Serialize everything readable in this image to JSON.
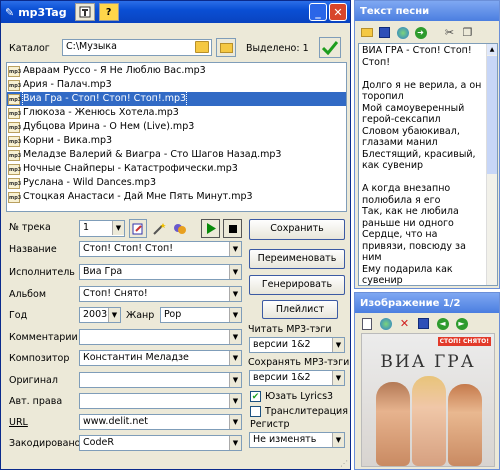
{
  "app": {
    "title": "mp3Tag"
  },
  "catalog": {
    "label": "Каталог",
    "path": "C:\\Музыка",
    "selected_text": "Выделено: 1"
  },
  "files": [
    {
      "name": "Авраам Руссо - Я Не Люблю Вас.mp3",
      "selected": false
    },
    {
      "name": "Ария - Палач.mp3",
      "selected": false
    },
    {
      "name": "Виа Гра - Стоп! Стоп! Стоп!.mp3",
      "selected": true
    },
    {
      "name": "Глюкоза - Женюсь Хотела.mp3",
      "selected": false
    },
    {
      "name": "Дубцова Ирина - О Нем (Live).mp3",
      "selected": false
    },
    {
      "name": "Корни - Вика.mp3",
      "selected": false
    },
    {
      "name": "Меладзе Валерий & Виагра - Сто Шагов Назад.mp3",
      "selected": false
    },
    {
      "name": "Ночные Снайперы - Катастрофически.mp3",
      "selected": false
    },
    {
      "name": "Руслана - Wild Dances.mp3",
      "selected": false
    },
    {
      "name": "Стоцкая Анастаси - Дай Мне Пять Минут.mp3",
      "selected": false
    }
  ],
  "tags": {
    "track_label": "№ трека",
    "track_value": "1",
    "title_label": "Название",
    "title_value": "Стоп! Стоп! Стоп!",
    "artist_label": "Исполнитель",
    "artist_value": "Виа Гра",
    "album_label": "Альбом",
    "album_value": "Стоп! Снято!",
    "year_label": "Год",
    "year_value": "2003",
    "genre_label": "Жанр",
    "genre_value": "Pop",
    "comments_label": "Комментарии",
    "comments_value": "",
    "composer_label": "Композитор",
    "composer_value": "Константин Меладзе",
    "original_label": "Оригинал",
    "original_value": "",
    "copyright_label": "Авт. права",
    "copyright_value": "",
    "url_label": "URL",
    "url_value": "www.delit.net",
    "encoded_label": "Закодировано",
    "encoded_value": "CodeR"
  },
  "buttons": {
    "save": "Сохранить",
    "rename": "Переименовать",
    "generate": "Генерировать",
    "playlist": "Плейлист"
  },
  "options": {
    "read_label": "Читать MP3-тэги",
    "read_value": "версии 1&2",
    "save_label": "Сохранять MP3-тэги",
    "save_value": "версии 1&2",
    "lyrics3_label": "Юзать Lyrics3",
    "lyrics3_checked": true,
    "translit_label": "Транслитерация",
    "translit_checked": false,
    "case_label": "Регистр",
    "case_value": "Не изменять"
  },
  "lyrics_panel": {
    "title": "Текст песни",
    "text": "ВИА ГРА - Стоп! Стоп! Стоп!\n\nДолго я не верила, а он торопил\nМой самоуверенный герой-сексапил\nСловом убаюкивал, глазами манил\nБлестящий, красивый, как сувенир\n\nА когда внезапно полюбила я его\nТак, как не любила раньше ни одного\nСердце, что на привязи, повсюду за ним\nЕму подарила как сувенир\n\nПодарила сердце на"
  },
  "image_panel": {
    "title": "Изображение 1/2",
    "cover_text": "ВИА ГРА",
    "cover_badge": "СТОП! СНЯТО!"
  },
  "colors": {
    "title_bar": "#0a4fd4",
    "selection": "#316ac5",
    "panel_title": "#5f8ee6"
  }
}
